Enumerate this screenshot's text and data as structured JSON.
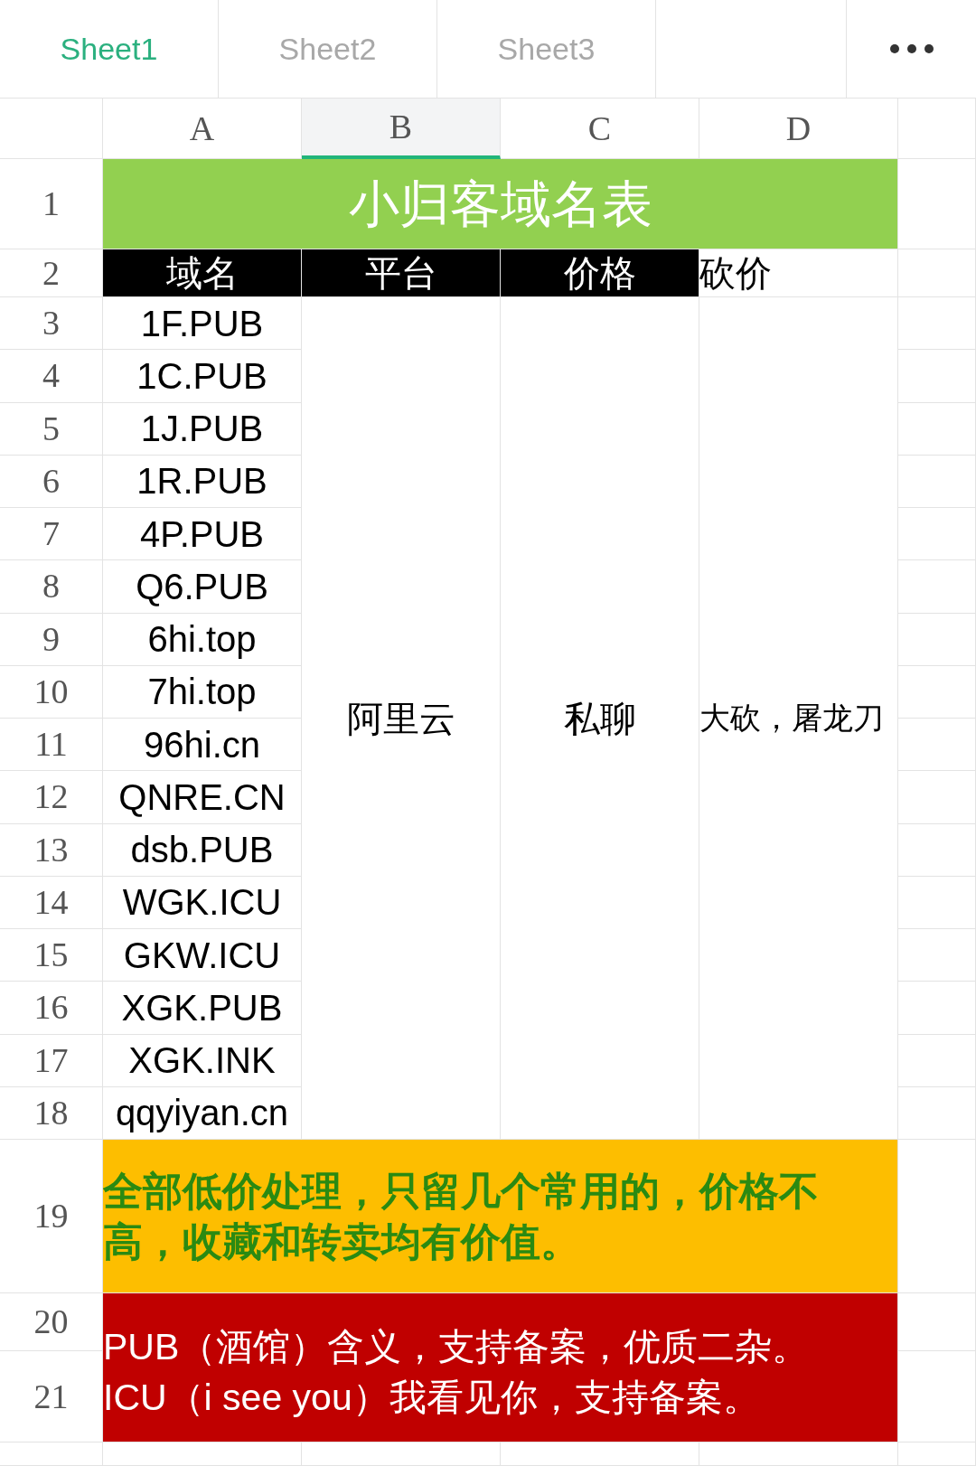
{
  "tabs": [
    {
      "label": "Sheet1",
      "selected": true
    },
    {
      "label": "Sheet2",
      "selected": false
    },
    {
      "label": "Sheet3",
      "selected": false
    }
  ],
  "columns": [
    {
      "label": "A",
      "selected": false
    },
    {
      "label": "B",
      "selected": true
    },
    {
      "label": "C",
      "selected": false
    },
    {
      "label": "D",
      "selected": false
    }
  ],
  "row_numbers": [
    "1",
    "2",
    "3",
    "4",
    "5",
    "6",
    "7",
    "8",
    "9",
    "10",
    "11",
    "12",
    "13",
    "14",
    "15",
    "16",
    "17",
    "18",
    "19",
    "20",
    "21"
  ],
  "title": "小归客域名表",
  "header": [
    {
      "text": "域名",
      "highlighted": true
    },
    {
      "text": "平台",
      "highlighted": true
    },
    {
      "text": "价格",
      "highlighted": true
    },
    {
      "text": "砍价",
      "highlighted": false
    }
  ],
  "domains": [
    "1F.PUB",
    "1C.PUB",
    "1J.PUB",
    "1R.PUB",
    "4P.PUB",
    "Q6.PUB",
    "6hi.top",
    "7hi.top",
    "96hi.cn",
    "QNRE.CN",
    "dsb.PUB",
    "WGK.ICU",
    "GKW.ICU",
    "XGK.PUB",
    "XGK.INK",
    "qqyiyan.cn"
  ],
  "platform": "阿里云",
  "price": "私聊",
  "bargain": "大砍，屠龙刀",
  "note": "全部低价处理，只留几个常用的，价格不高，收藏和转卖均有价值。",
  "info_lines": [
    "PUB（酒馆）含义，支持备案，优质二杂。",
    "ICU（i see you）我看见你，支持备案。"
  ]
}
